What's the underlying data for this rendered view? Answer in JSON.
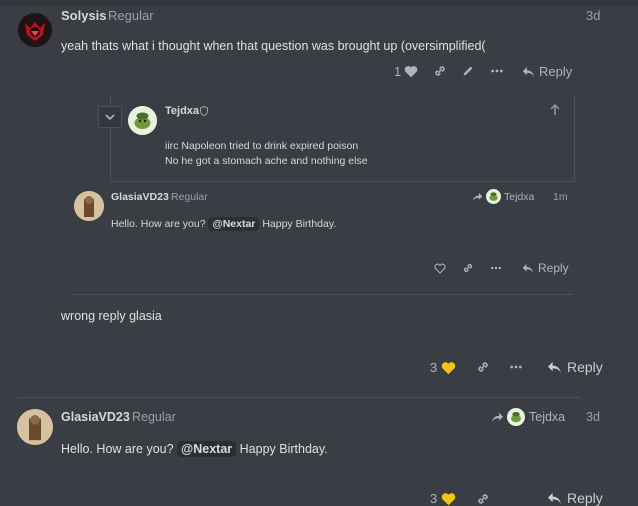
{
  "post1": {
    "username": "Solysis",
    "user_title": "Regular",
    "time": "3d",
    "body": "yeah thats what i thought when that question was brought up (oversimplified(",
    "likes": "1",
    "reply_label": "Reply"
  },
  "quote": {
    "username": "Tejdxa",
    "line1": "iirc Napoleon tried to drink expired poison",
    "line2": "No he got a stomach ache and nothing else"
  },
  "embedded": {
    "username": "GlasiaVD23",
    "user_title": "Regular",
    "reply_to": "Tejdxa",
    "time": "1m",
    "body_pre": "Hello. How are you?",
    "mention": "@Nextar",
    "body_post": "Happy Birthday.",
    "reply_label": "Reply"
  },
  "post1_cont": {
    "body": "wrong reply glasia",
    "likes": "3",
    "reply_label": "Reply"
  },
  "post2": {
    "username": "GlasiaVD23",
    "user_title": "Regular",
    "reply_to": "Tejdxa",
    "time": "3d",
    "body_pre": "Hello. How are you?",
    "mention": "@Nextar",
    "body_post": "Happy Birthday.",
    "likes": "3",
    "reply_label": "Reply"
  },
  "colors": {
    "background": "#3a3d44",
    "like_heart": "#f0c419",
    "avatar_red": "#c0101a"
  }
}
